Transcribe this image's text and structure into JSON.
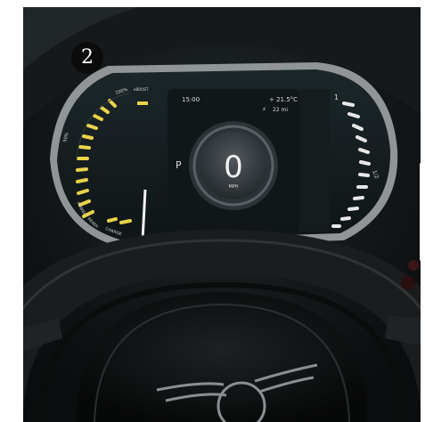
{
  "badge": {
    "number": "2"
  },
  "display": {
    "clock": "15:00",
    "temperature": "+ 21.5°C",
    "range": "22 mi",
    "gear": "P",
    "speed_value": "0",
    "speed_unit": "MPH",
    "battery_label": "100%",
    "battery_label_mid": "50%",
    "battery_label_extra": "eBOOST",
    "status_labels": [
      "POWER",
      "READY",
      "CHARGE"
    ],
    "right_gauge_top": "1",
    "right_gauge_mid": "1/2"
  },
  "colors": {
    "gauge_yellow": "#e9d34a",
    "gauge_white": "#e8e8e8",
    "badge": "#0b0b0b"
  }
}
